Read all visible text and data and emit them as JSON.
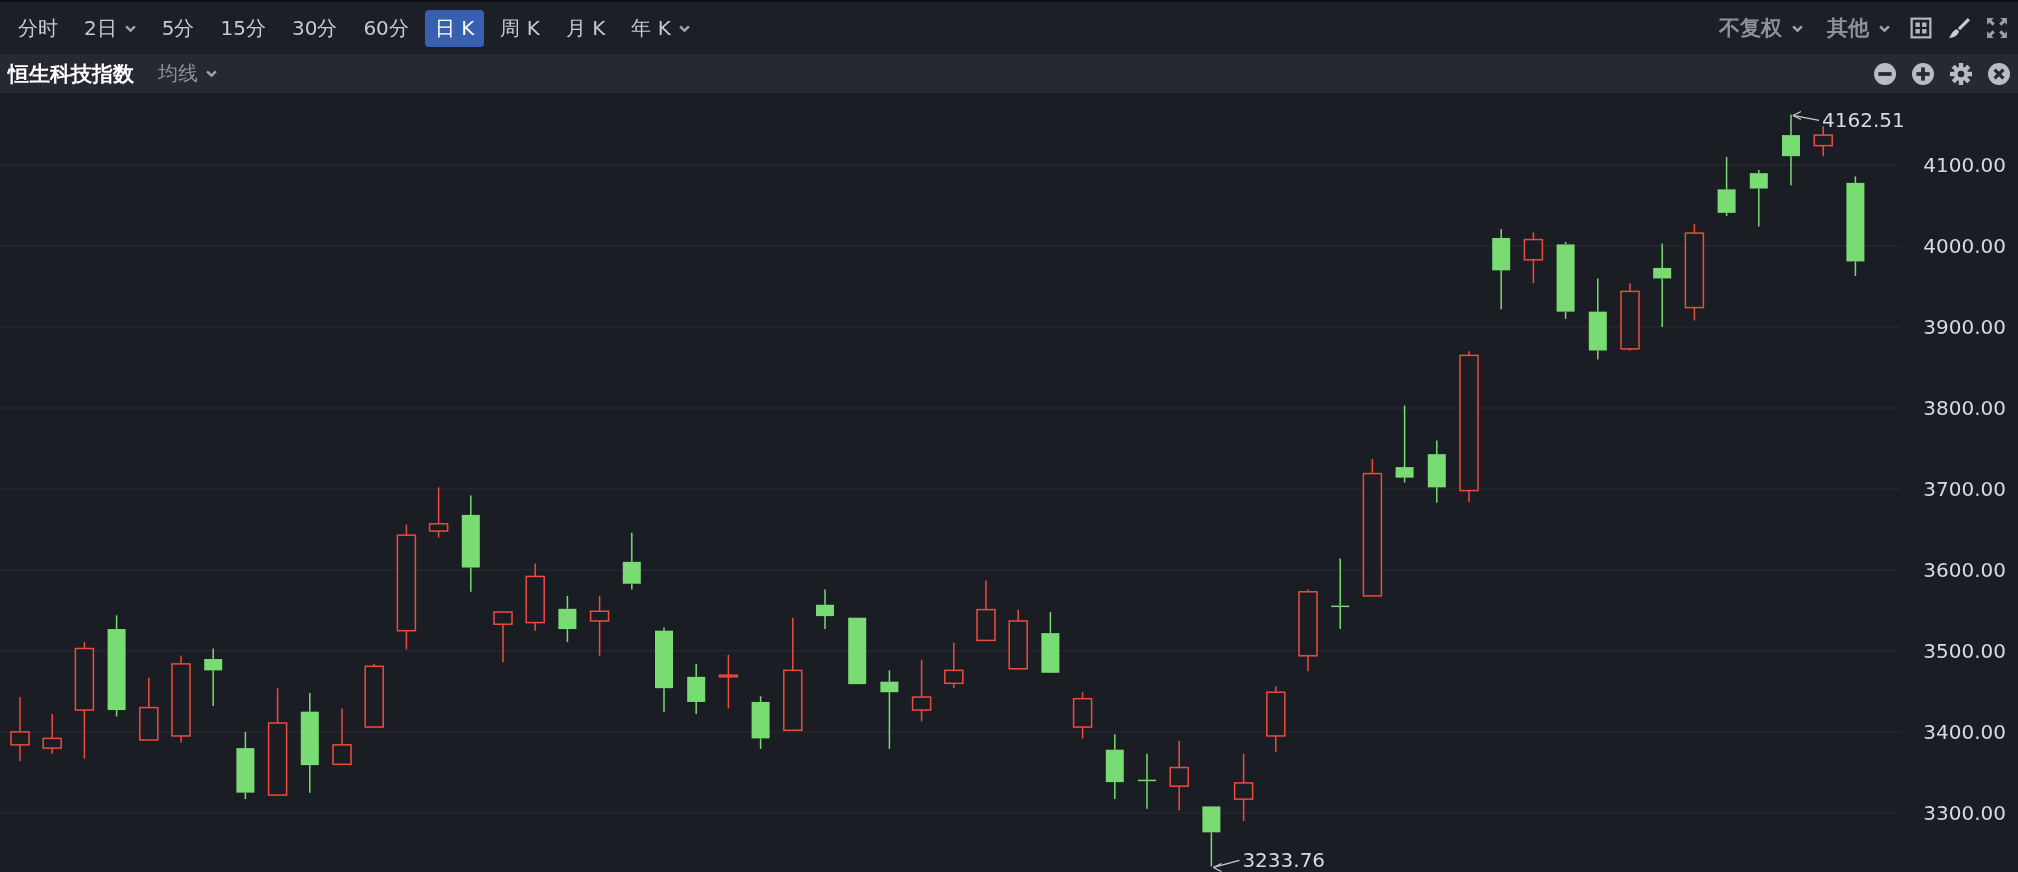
{
  "toolbar": {
    "tabs": [
      {
        "label": "分时",
        "selected": false,
        "dropdown": false
      },
      {
        "label": "2日",
        "selected": false,
        "dropdown": true
      },
      {
        "label": "5分",
        "selected": false,
        "dropdown": false
      },
      {
        "label": "15分",
        "selected": false,
        "dropdown": false
      },
      {
        "label": "30分",
        "selected": false,
        "dropdown": false
      },
      {
        "label": "60分",
        "selected": false,
        "dropdown": false
      },
      {
        "label": "日 K",
        "selected": true,
        "dropdown": false
      },
      {
        "label": "周 K",
        "selected": false,
        "dropdown": false
      },
      {
        "label": "月 K",
        "selected": false,
        "dropdown": false
      },
      {
        "label": "年 K",
        "selected": false,
        "dropdown": true
      }
    ],
    "menus": [
      {
        "label": "不复权"
      },
      {
        "label": "其他"
      }
    ]
  },
  "panel": {
    "title": "恒生科技指数",
    "indicator": "均线",
    "price_axis_labels": [
      "4100.00",
      "4000.00",
      "3900.00",
      "3800.00",
      "3700.00",
      "3600.00",
      "3500.00",
      "3400.00",
      "3300.00"
    ],
    "high_label": "4162.51",
    "low_label": "3233.76"
  }
}
